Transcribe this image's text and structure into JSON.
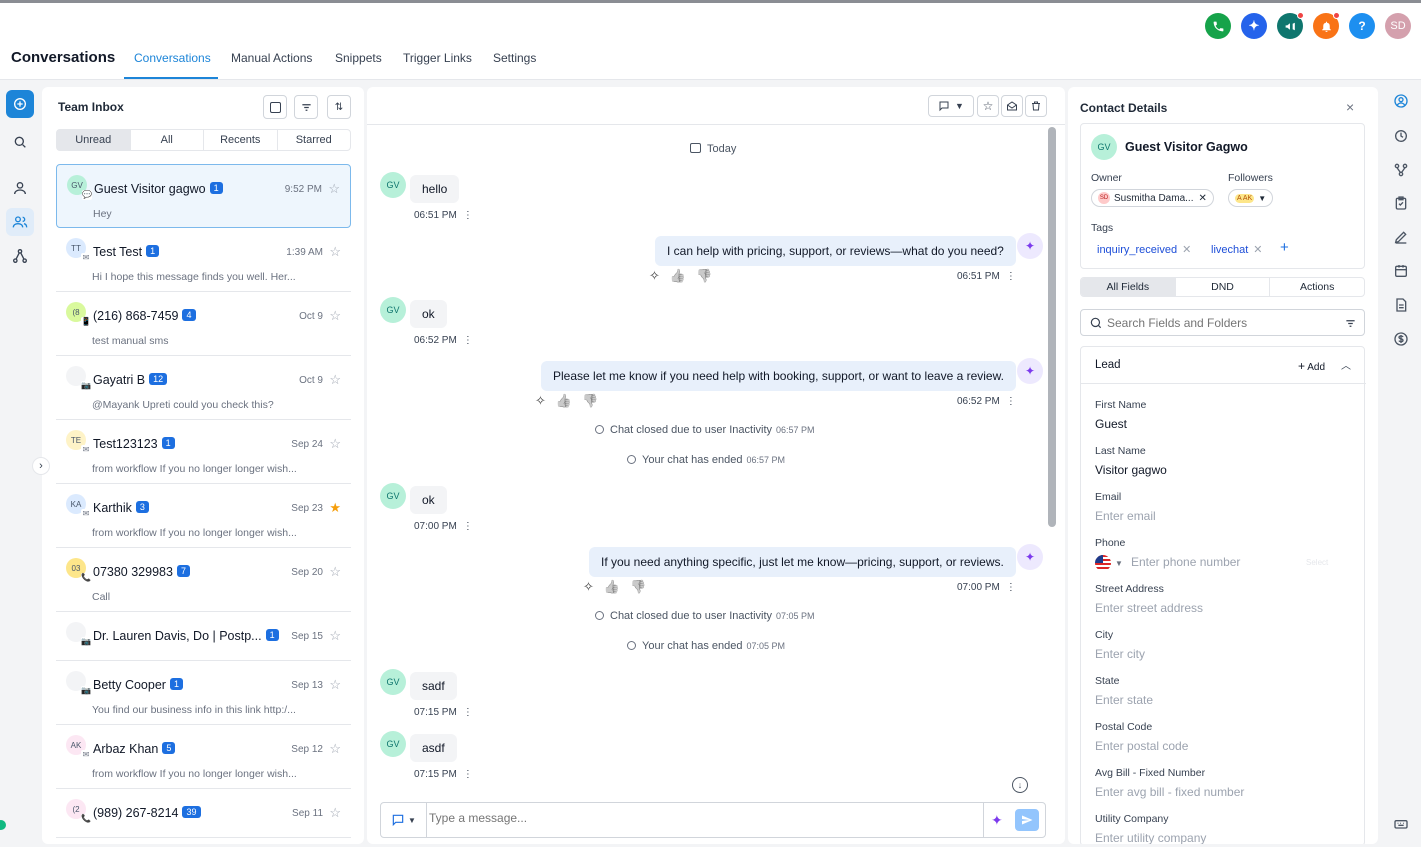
{
  "app": {
    "title": "Conversations"
  },
  "nav": {
    "tabs": [
      "Conversations",
      "Manual Actions",
      "Snippets",
      "Trigger Links",
      "Settings"
    ],
    "active": 0
  },
  "header": {
    "user_initials": "SD",
    "help": "?"
  },
  "inbox": {
    "title": "Team Inbox",
    "filters": [
      "Unread",
      "All",
      "Recents",
      "Starred"
    ],
    "conversations": [
      {
        "initials": "GV",
        "name": "Guest Visitor gagwo",
        "badge": "1",
        "time": "9:52 PM",
        "preview": "Hey",
        "av_color": "#b7f0d9"
      },
      {
        "initials": "TT",
        "name": "Test Test",
        "badge": "1",
        "time": "1:39 AM",
        "preview": "Hi I hope this message finds you well. Her...",
        "av_color": "#dbeafe"
      },
      {
        "initials": "(8",
        "name": "(216) 868-7459",
        "badge": "4",
        "time": "Oct 9",
        "preview": "test manual sms",
        "av_color": "#d9f99d"
      },
      {
        "initials": "",
        "name": "Gayatri B",
        "badge": "12",
        "time": "Oct 9",
        "preview": "@Mayank Upreti could you check this?",
        "av_color": "#f3f4f6"
      },
      {
        "initials": "TE",
        "name": "Test123123",
        "badge": "1",
        "time": "Sep 24",
        "preview": "from workflow If you no longer longer wish...",
        "av_color": "#fef3c7"
      },
      {
        "initials": "KA",
        "name": "Karthik",
        "badge": "3",
        "time": "Sep 23",
        "preview": "from workflow If you no longer longer wish...",
        "av_color": "#dbeafe"
      },
      {
        "initials": "03",
        "name": "07380 329983",
        "badge": "7",
        "time": "Sep 20",
        "preview": "Call",
        "av_color": "#fde68a"
      },
      {
        "initials": "",
        "name": "Dr. Lauren Davis, Do | Postp...",
        "badge": "1",
        "time": "Sep 15",
        "preview": "",
        "av_color": "#f3f4f6"
      },
      {
        "initials": "",
        "name": "Betty Cooper",
        "badge": "1",
        "time": "Sep 13",
        "preview": "You find our business info in this link http:/...",
        "av_color": "#f3f4f6"
      },
      {
        "initials": "AK",
        "name": "Arbaz Khan",
        "badge": "5",
        "time": "Sep 12",
        "preview": "from workflow If you no longer longer wish...",
        "av_color": "#fce7f3"
      },
      {
        "initials": "(2",
        "name": "(989) 267-8214",
        "badge": "39",
        "time": "Sep 11",
        "preview": "",
        "av_color": "#fce7f3"
      }
    ]
  },
  "chat": {
    "date_label": "Today",
    "visitor_initials": "GV",
    "messages": [
      {
        "dir": "in",
        "text": "hello",
        "time": "06:51 PM"
      },
      {
        "dir": "out",
        "text": "I can help with pricing, support, or reviews—what do you need?",
        "time": "06:51 PM"
      },
      {
        "dir": "in",
        "text": "ok",
        "time": "06:52 PM"
      },
      {
        "dir": "out",
        "text": "Please let me know if you need help with booking, support, or want to leave a review.",
        "time": "06:52 PM"
      },
      {
        "dir": "sys",
        "text": "Chat closed due to user Inactivity",
        "time": "06:57 PM"
      },
      {
        "dir": "sys",
        "text": "Your chat has ended",
        "time": "06:57 PM"
      },
      {
        "dir": "in",
        "text": "ok",
        "time": "07:00 PM"
      },
      {
        "dir": "out",
        "text": "If you need anything specific, just let me know—pricing, support, or reviews.",
        "time": "07:00 PM"
      },
      {
        "dir": "sys",
        "text": "Chat closed due to user Inactivity",
        "time": "07:05 PM"
      },
      {
        "dir": "sys",
        "text": "Your chat has ended",
        "time": "07:05 PM"
      },
      {
        "dir": "in",
        "text": "sadf",
        "time": "07:15 PM"
      },
      {
        "dir": "in",
        "text": "asdf",
        "time": "07:15 PM"
      }
    ],
    "composer_placeholder": "Type a message..."
  },
  "contact": {
    "title": "Contact Details",
    "name": "Guest Visitor Gagwo",
    "initials": "GV",
    "owner_label": "Owner",
    "owner_initials": "SD",
    "owner_name": "Susmitha Dama...",
    "followers_label": "Followers",
    "follower_initials": "A AK",
    "tags_label": "Tags",
    "tags": [
      "inquiry_received",
      "livechat"
    ],
    "tabs": [
      "All Fields",
      "DND",
      "Actions"
    ],
    "search_placeholder": "Search Fields and Folders",
    "section": "Lead",
    "add_label": "Add",
    "fields": [
      {
        "label": "First Name",
        "value": "Guest",
        "placeholder": ""
      },
      {
        "label": "Last Name",
        "value": "Visitor gagwo",
        "placeholder": ""
      },
      {
        "label": "Email",
        "value": "",
        "placeholder": "Enter email"
      },
      {
        "label": "Phone",
        "value": "",
        "placeholder": "Enter phone number"
      },
      {
        "label": "Street Address",
        "value": "",
        "placeholder": "Enter street address"
      },
      {
        "label": "City",
        "value": "",
        "placeholder": "Enter city"
      },
      {
        "label": "State",
        "value": "",
        "placeholder": "Enter state"
      },
      {
        "label": "Postal Code",
        "value": "",
        "placeholder": "Enter postal code"
      },
      {
        "label": "Avg Bill - Fixed Number",
        "value": "",
        "placeholder": "Enter avg bill - fixed number"
      },
      {
        "label": "Utility Company",
        "value": "",
        "placeholder": "Enter utility company"
      }
    ],
    "phone_select": "Select"
  },
  "colors": {
    "accent": "#1d85d8",
    "badge": "#1d6fe0",
    "phone": "#16a34a",
    "ai": "#2563eb",
    "megaphone": "#0f766e",
    "bell": "#f97316",
    "help": "#1d8ff0",
    "avatar": "#d4a0ad"
  }
}
